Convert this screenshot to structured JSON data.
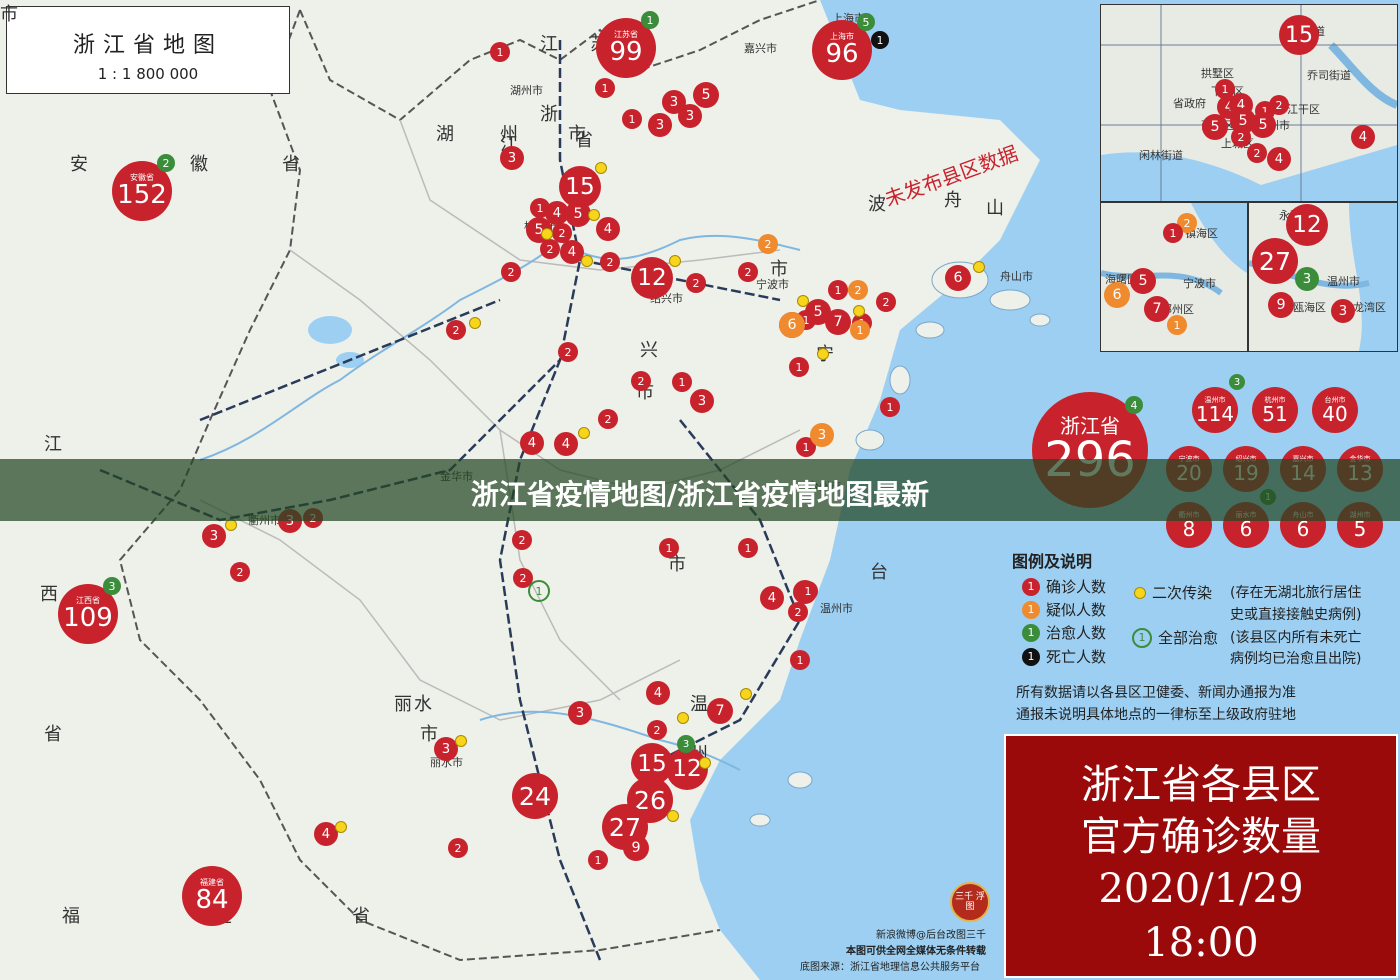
{
  "title": {
    "main": "浙江省地图",
    "scale": "1 : 1 800 000"
  },
  "banner": "浙江省疫情地图/浙江省疫情地图最新",
  "overlay_text": "未发布县区数据",
  "legend": {
    "heading": "图例及说明",
    "confirmed": "确诊人数",
    "suspected": "疑似人数",
    "recovered": "治愈人数",
    "death": "死亡人数",
    "secondary": "二次传染",
    "secondary_note1": "(存在无湖北旅行居住",
    "secondary_note2": "史或直接接触史病例)",
    "all_recovered": "全部治愈",
    "all_recovered_note1": "(该县区内所有未死亡",
    "all_recovered_note2": "病例均已治愈且出院)",
    "note1": "所有数据请以各县区卫健委、新闻办通报为准",
    "note2": "通报未说明具体地点的一律标至上级政府驻地",
    "legend_num_confirmed": "1",
    "legend_num_suspected": "1",
    "legend_num_recovered": "1",
    "legend_num_death": "1"
  },
  "redbox": {
    "line1": "浙江省各县区",
    "line2": "官方确诊数量",
    "line3": "2020/1/29",
    "line4": "18:00"
  },
  "credits": {
    "line1": "新浪微博@后台改图三千",
    "line2": "本图可供全网全媒体无条件转载",
    "line3": "底图来源：浙江省地理信息公共服务平台",
    "seal": "三千 浮图"
  },
  "colors": {
    "confirmed": "#c8232c",
    "suspected": "#ef8a2e",
    "recovered": "#3b8d3b",
    "death": "#111111",
    "secondary": "#f7d51d",
    "sea": "#9ccff2",
    "land": "#eef0ea"
  },
  "province_total": {
    "name": "浙江省",
    "count": "296",
    "recovered": "4"
  },
  "city_totals": [
    {
      "name": "温州市",
      "count": "114",
      "recovered": "3"
    },
    {
      "name": "杭州市",
      "count": "51"
    },
    {
      "name": "台州市",
      "count": "40"
    },
    {
      "name": "宁波市",
      "count": "20"
    },
    {
      "name": "绍兴市",
      "count": "19"
    },
    {
      "name": "嘉兴市",
      "count": "14"
    },
    {
      "name": "金华市",
      "count": "13"
    },
    {
      "name": "衢州市",
      "count": "8"
    },
    {
      "name": "丽水市",
      "count": "6",
      "recovered": "1"
    },
    {
      "name": "舟山市",
      "count": "6"
    },
    {
      "name": "湖州市",
      "count": "5"
    }
  ],
  "neighbors": [
    {
      "name": "江苏省",
      "count": "99",
      "recovered": "1"
    },
    {
      "name": "上海市",
      "count": "96",
      "recovered": "5",
      "death": "1"
    },
    {
      "name": "安徽省",
      "count": "152",
      "recovered": "2"
    },
    {
      "name": "江西省",
      "count": "109",
      "recovered": "3"
    },
    {
      "name": "福建省",
      "count": "84"
    }
  ],
  "map_bubbles": [
    "1",
    "1",
    "1",
    "3",
    "3",
    "5",
    "3",
    "3",
    "15",
    "1",
    "5",
    "5",
    "4",
    "2",
    "2",
    "4",
    "4",
    "2",
    "12",
    "2",
    "2",
    "2",
    "2",
    "5",
    "7",
    "1",
    "1",
    "2",
    "6",
    "6",
    "2",
    "1",
    "3",
    "2",
    "2",
    "1",
    "1",
    "1",
    "3",
    "1",
    "4",
    "4",
    "2",
    "3",
    "1",
    "2",
    "2",
    "2",
    "1",
    "4",
    "4",
    "2",
    "1",
    "4",
    "7",
    "2",
    "15",
    "12",
    "26",
    "27",
    "9",
    "3",
    "24",
    "4",
    "3",
    "2",
    "1",
    "1",
    "1",
    "3",
    "2",
    "1",
    "3",
    "2",
    "1",
    "1"
  ],
  "inset_hz": {
    "count": "15",
    "labels": [
      "拱墅区",
      "下城区",
      "西湖区",
      "江干区",
      "上城区",
      "杭州市",
      "省政府",
      "闲林街道",
      "乔司街道",
      "南苑街道"
    ],
    "bubbles": [
      "1",
      "4",
      "4",
      "1",
      "5",
      "5",
      "5",
      "2",
      "2",
      "4",
      "4",
      "2"
    ]
  },
  "inset_nb": {
    "labels": [
      "镇海区",
      "宁波市",
      "海曙区",
      "鄞州区"
    ],
    "bubbles": [
      "2",
      "1",
      "5",
      "7",
      "1",
      "6"
    ]
  },
  "inset_wz": {
    "labels": [
      "永嘉县",
      "温州市",
      "瓯海区",
      "龙湾区"
    ],
    "bubbles": [
      "12",
      "27",
      "3",
      "9",
      "3"
    ]
  },
  "place_labels": [
    "上海市",
    "湖州市",
    "嘉兴市",
    "杭州市",
    "绍兴市",
    "宁波市",
    "舟山市",
    "衢州市",
    "金华市",
    "台州市",
    "丽水市",
    "温州市",
    "江",
    "苏",
    "安",
    "徽",
    "省",
    "浙",
    "江",
    "省",
    "江",
    "西",
    "省",
    "福",
    "建",
    "省",
    "湖",
    "州",
    "市",
    "兴",
    "市",
    "丽",
    "水",
    "市",
    "温",
    "州",
    "市",
    "台",
    "市",
    "宁",
    "波",
    "舟",
    "山",
    "市"
  ]
}
